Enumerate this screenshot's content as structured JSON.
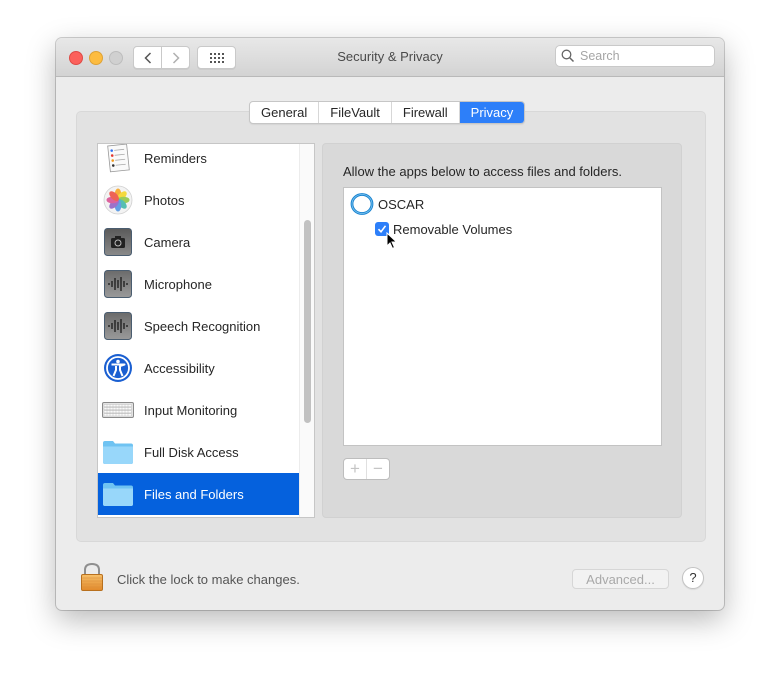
{
  "window": {
    "title": "Security & Privacy",
    "traffic_lights": [
      "close",
      "minimize",
      "zoom"
    ],
    "toolbar": {
      "back_icon": "chevron-left-icon",
      "forward_icon": "chevron-right-icon",
      "show_all_icon": "grid-icon"
    },
    "search": {
      "placeholder": "Search",
      "value": ""
    }
  },
  "tabs": [
    {
      "label": "General",
      "active": false
    },
    {
      "label": "FileVault",
      "active": false
    },
    {
      "label": "Firewall",
      "active": false
    },
    {
      "label": "Privacy",
      "active": true
    }
  ],
  "categories": [
    {
      "label": "Reminders",
      "icon": "reminders-icon",
      "selected": false
    },
    {
      "label": "Photos",
      "icon": "photos-icon",
      "selected": false
    },
    {
      "label": "Camera",
      "icon": "camera-icon",
      "selected": false
    },
    {
      "label": "Microphone",
      "icon": "microphone-icon",
      "selected": false
    },
    {
      "label": "Speech Recognition",
      "icon": "speech-recognition-icon",
      "selected": false
    },
    {
      "label": "Accessibility",
      "icon": "accessibility-icon",
      "selected": false
    },
    {
      "label": "Input Monitoring",
      "icon": "keyboard-icon",
      "selected": false
    },
    {
      "label": "Full Disk Access",
      "icon": "folder-icon",
      "selected": false
    },
    {
      "label": "Files and Folders",
      "icon": "folder-icon",
      "selected": true
    }
  ],
  "detail": {
    "description": "Allow the apps below to access files and folders.",
    "apps": [
      {
        "name": "OSCAR",
        "icon": "oscar-app-icon",
        "permissions": [
          {
            "label": "Removable Volumes",
            "checked": true
          }
        ]
      }
    ],
    "add_label": "+",
    "remove_label": "−"
  },
  "footer": {
    "lock_text": "Click the lock to make changes.",
    "advanced_label": "Advanced...",
    "help_label": "?"
  },
  "colors": {
    "accent": "#2d7ff9",
    "selection": "#0561dd"
  }
}
